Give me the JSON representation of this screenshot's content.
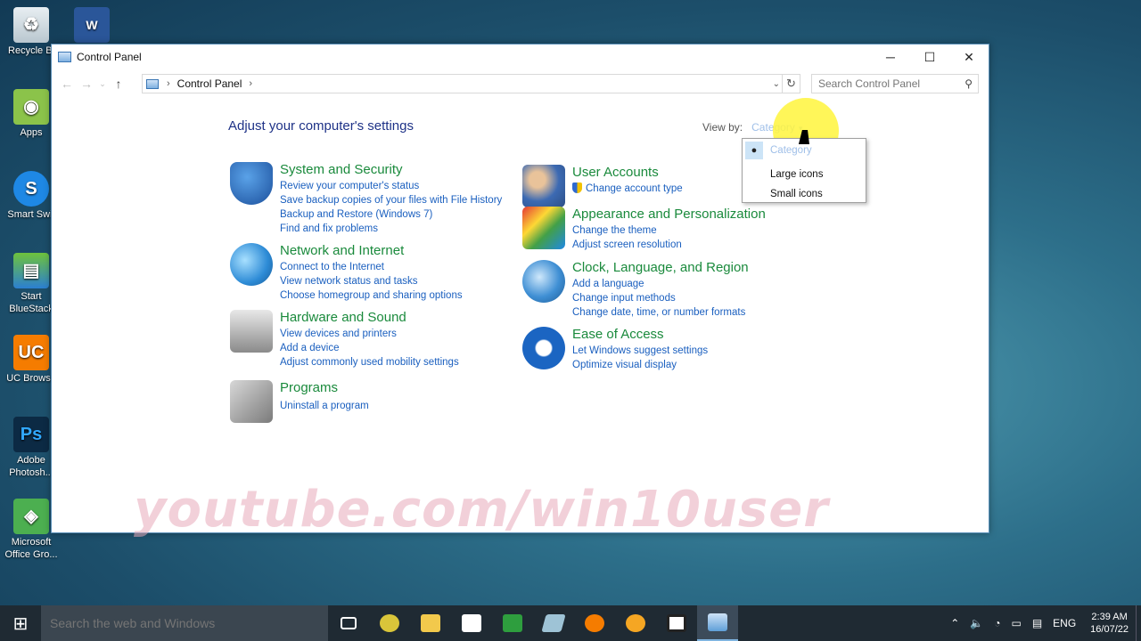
{
  "desktop": {
    "icons": [
      {
        "label": "Recycle Bi"
      },
      {
        "label": "Apps"
      },
      {
        "label": "Smart Swit"
      },
      {
        "label": "Start BlueStack"
      },
      {
        "label": "UC Browse"
      },
      {
        "label": "Adobe Photosh..."
      },
      {
        "label": "Microsoft Office Gro..."
      }
    ]
  },
  "window": {
    "title": "Control Panel",
    "breadcrumb": "Control Panel",
    "search_placeholder": "Search Control Panel",
    "heading": "Adjust your computer's settings",
    "view_by_label": "View by:",
    "view_by_value": "Category",
    "view_options": [
      "Category",
      "Large icons",
      "Small icons"
    ],
    "categories": [
      {
        "title": "System and Security",
        "links": [
          "Review your computer's status",
          "Save backup copies of your files with File History",
          "Backup and Restore (Windows 7)",
          "Find and fix problems"
        ]
      },
      {
        "title": "Network and Internet",
        "links": [
          "Connect to the Internet",
          "View network status and tasks",
          "Choose homegroup and sharing options"
        ]
      },
      {
        "title": "Hardware and Sound",
        "links": [
          "View devices and printers",
          "Add a device",
          "Adjust commonly used mobility settings"
        ]
      },
      {
        "title": "Programs",
        "links": [
          "Uninstall a program"
        ]
      },
      {
        "title": "User Accounts",
        "links": [
          "Change account type"
        ]
      },
      {
        "title": "Appearance and Personalization",
        "links": [
          "Change the theme",
          "Adjust screen resolution"
        ]
      },
      {
        "title": "Clock, Language, and Region",
        "links": [
          "Add a language",
          "Change input methods",
          "Change date, time, or number formats"
        ]
      },
      {
        "title": "Ease of Access",
        "links": [
          "Let Windows suggest settings",
          "Optimize visual display"
        ]
      }
    ]
  },
  "watermark": "youtube.com/win10user",
  "taskbar": {
    "search_placeholder": "Search the web and Windows",
    "language": "ENG",
    "time": "2:39 AM",
    "date": "16/07/22"
  }
}
